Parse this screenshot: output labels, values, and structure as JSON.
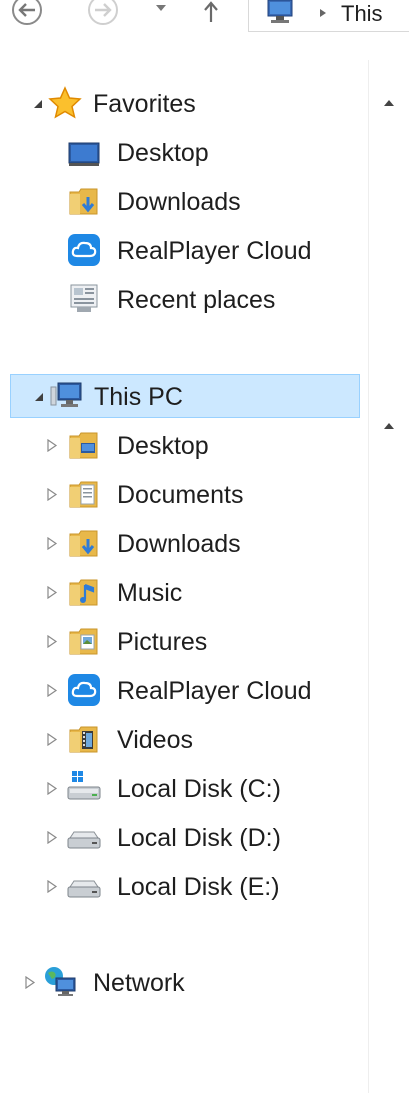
{
  "address": {
    "path_label": "This"
  },
  "favorites": {
    "label": "Favorites",
    "items": [
      {
        "label": "Desktop"
      },
      {
        "label": "Downloads"
      },
      {
        "label": "RealPlayer Cloud"
      },
      {
        "label": "Recent places"
      }
    ]
  },
  "this_pc": {
    "label": "This PC",
    "items": [
      {
        "label": "Desktop"
      },
      {
        "label": "Documents"
      },
      {
        "label": "Downloads"
      },
      {
        "label": "Music"
      },
      {
        "label": "Pictures"
      },
      {
        "label": "RealPlayer Cloud"
      },
      {
        "label": "Videos"
      },
      {
        "label": "Local Disk (C:)"
      },
      {
        "label": "Local Disk (D:)"
      },
      {
        "label": "Local Disk (E:)"
      }
    ]
  },
  "network": {
    "label": "Network"
  },
  "colors": {
    "selection": "#cce8ff",
    "selection_border": "#99d1ff"
  }
}
